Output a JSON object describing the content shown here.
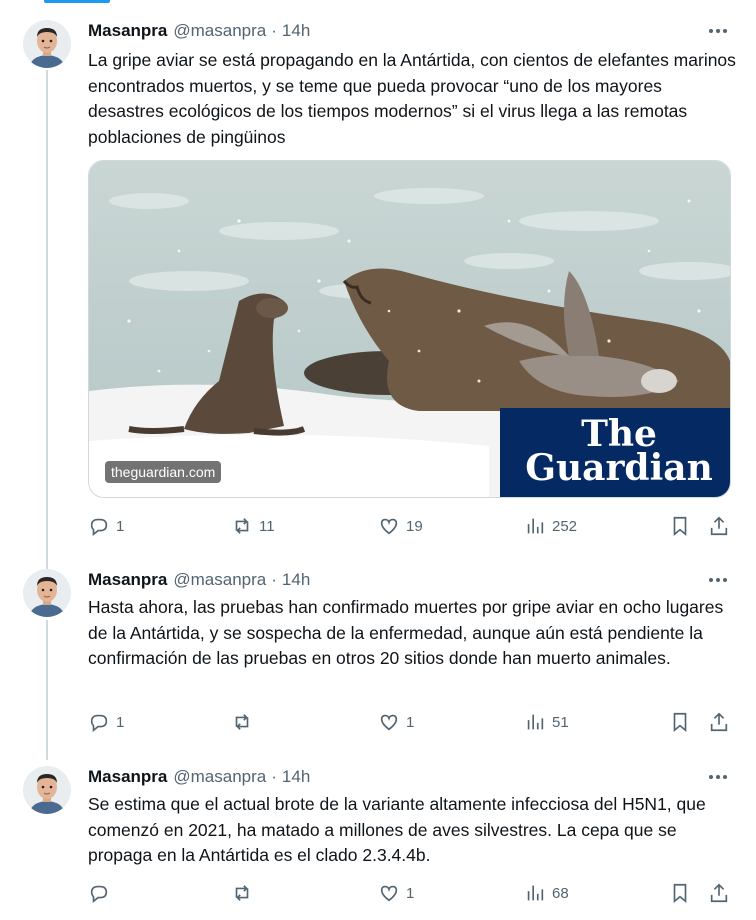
{
  "author": {
    "name": "Masanpra",
    "handle": "@masanpra"
  },
  "tweets": [
    {
      "time": "14h",
      "text": "La gripe aviar se está propagando en la Antártida, con cientos de elefantes marinos encontrados muertos, y se teme que pueda provocar “uno de los mayores desastres ecológicos de los tiempos modernos” si el virus llega a las remotas poblaciones de pingüinos",
      "card": {
        "domain": "theguardian.com",
        "brand_line1": "The",
        "brand_line2": "Guardian",
        "brand_color": "#052962"
      },
      "replies": "1",
      "retweets": "11",
      "likes": "19",
      "views": "252"
    },
    {
      "time": "14h",
      "text": "Hasta ahora, las pruebas han confirmado muertes por gripe aviar en ocho lugares de la Antártida, y se sospecha de la enfermedad, aunque aún está pendiente la confirmación de las pruebas en otros 20 sitios donde han muerto animales.",
      "replies": "1",
      "retweets": "",
      "likes": "1",
      "views": "51"
    },
    {
      "time": "14h",
      "text": "Se estima que el actual brote de la variante altamente infecciosa del H5N1, que comenzó en 2021, ha matado a millones de aves silvestres. La cepa que se propaga en la Antártida es el clado 2.3.4.4b.",
      "replies": "",
      "retweets": "",
      "likes": "1",
      "views": "68"
    }
  ],
  "colors": {
    "accent": "#1d9bf0",
    "text": "#0f1419",
    "secondary": "#536471",
    "border": "#cfd9de"
  },
  "icons": [
    "reply-icon",
    "retweet-icon",
    "like-icon",
    "views-icon",
    "bookmark-icon",
    "share-icon",
    "more-icon"
  ]
}
